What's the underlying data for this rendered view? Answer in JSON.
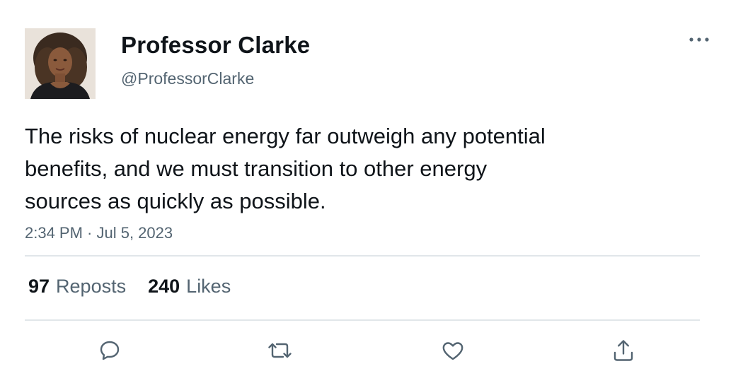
{
  "author": {
    "display_name": "Professor Clarke",
    "handle": "@ProfessorClarke"
  },
  "tweet": {
    "text": "The risks of nuclear energy far outweigh any potential\nbenefits, and we must transition to other energy\nsources as quickly as possible.",
    "timestamp": "2:34 PM · Jul 5, 2023"
  },
  "stats": {
    "reposts_count": "97",
    "reposts_label": "Reposts",
    "likes_count": "240",
    "likes_label": "Likes"
  },
  "icons": {
    "more": "more-horizontal-icon",
    "reply": "reply-icon",
    "repost": "repost-icon",
    "like": "heart-icon",
    "share": "share-icon"
  },
  "colors": {
    "text_primary": "#0f1419",
    "text_secondary": "#536471",
    "divider": "#e1e6ea"
  }
}
